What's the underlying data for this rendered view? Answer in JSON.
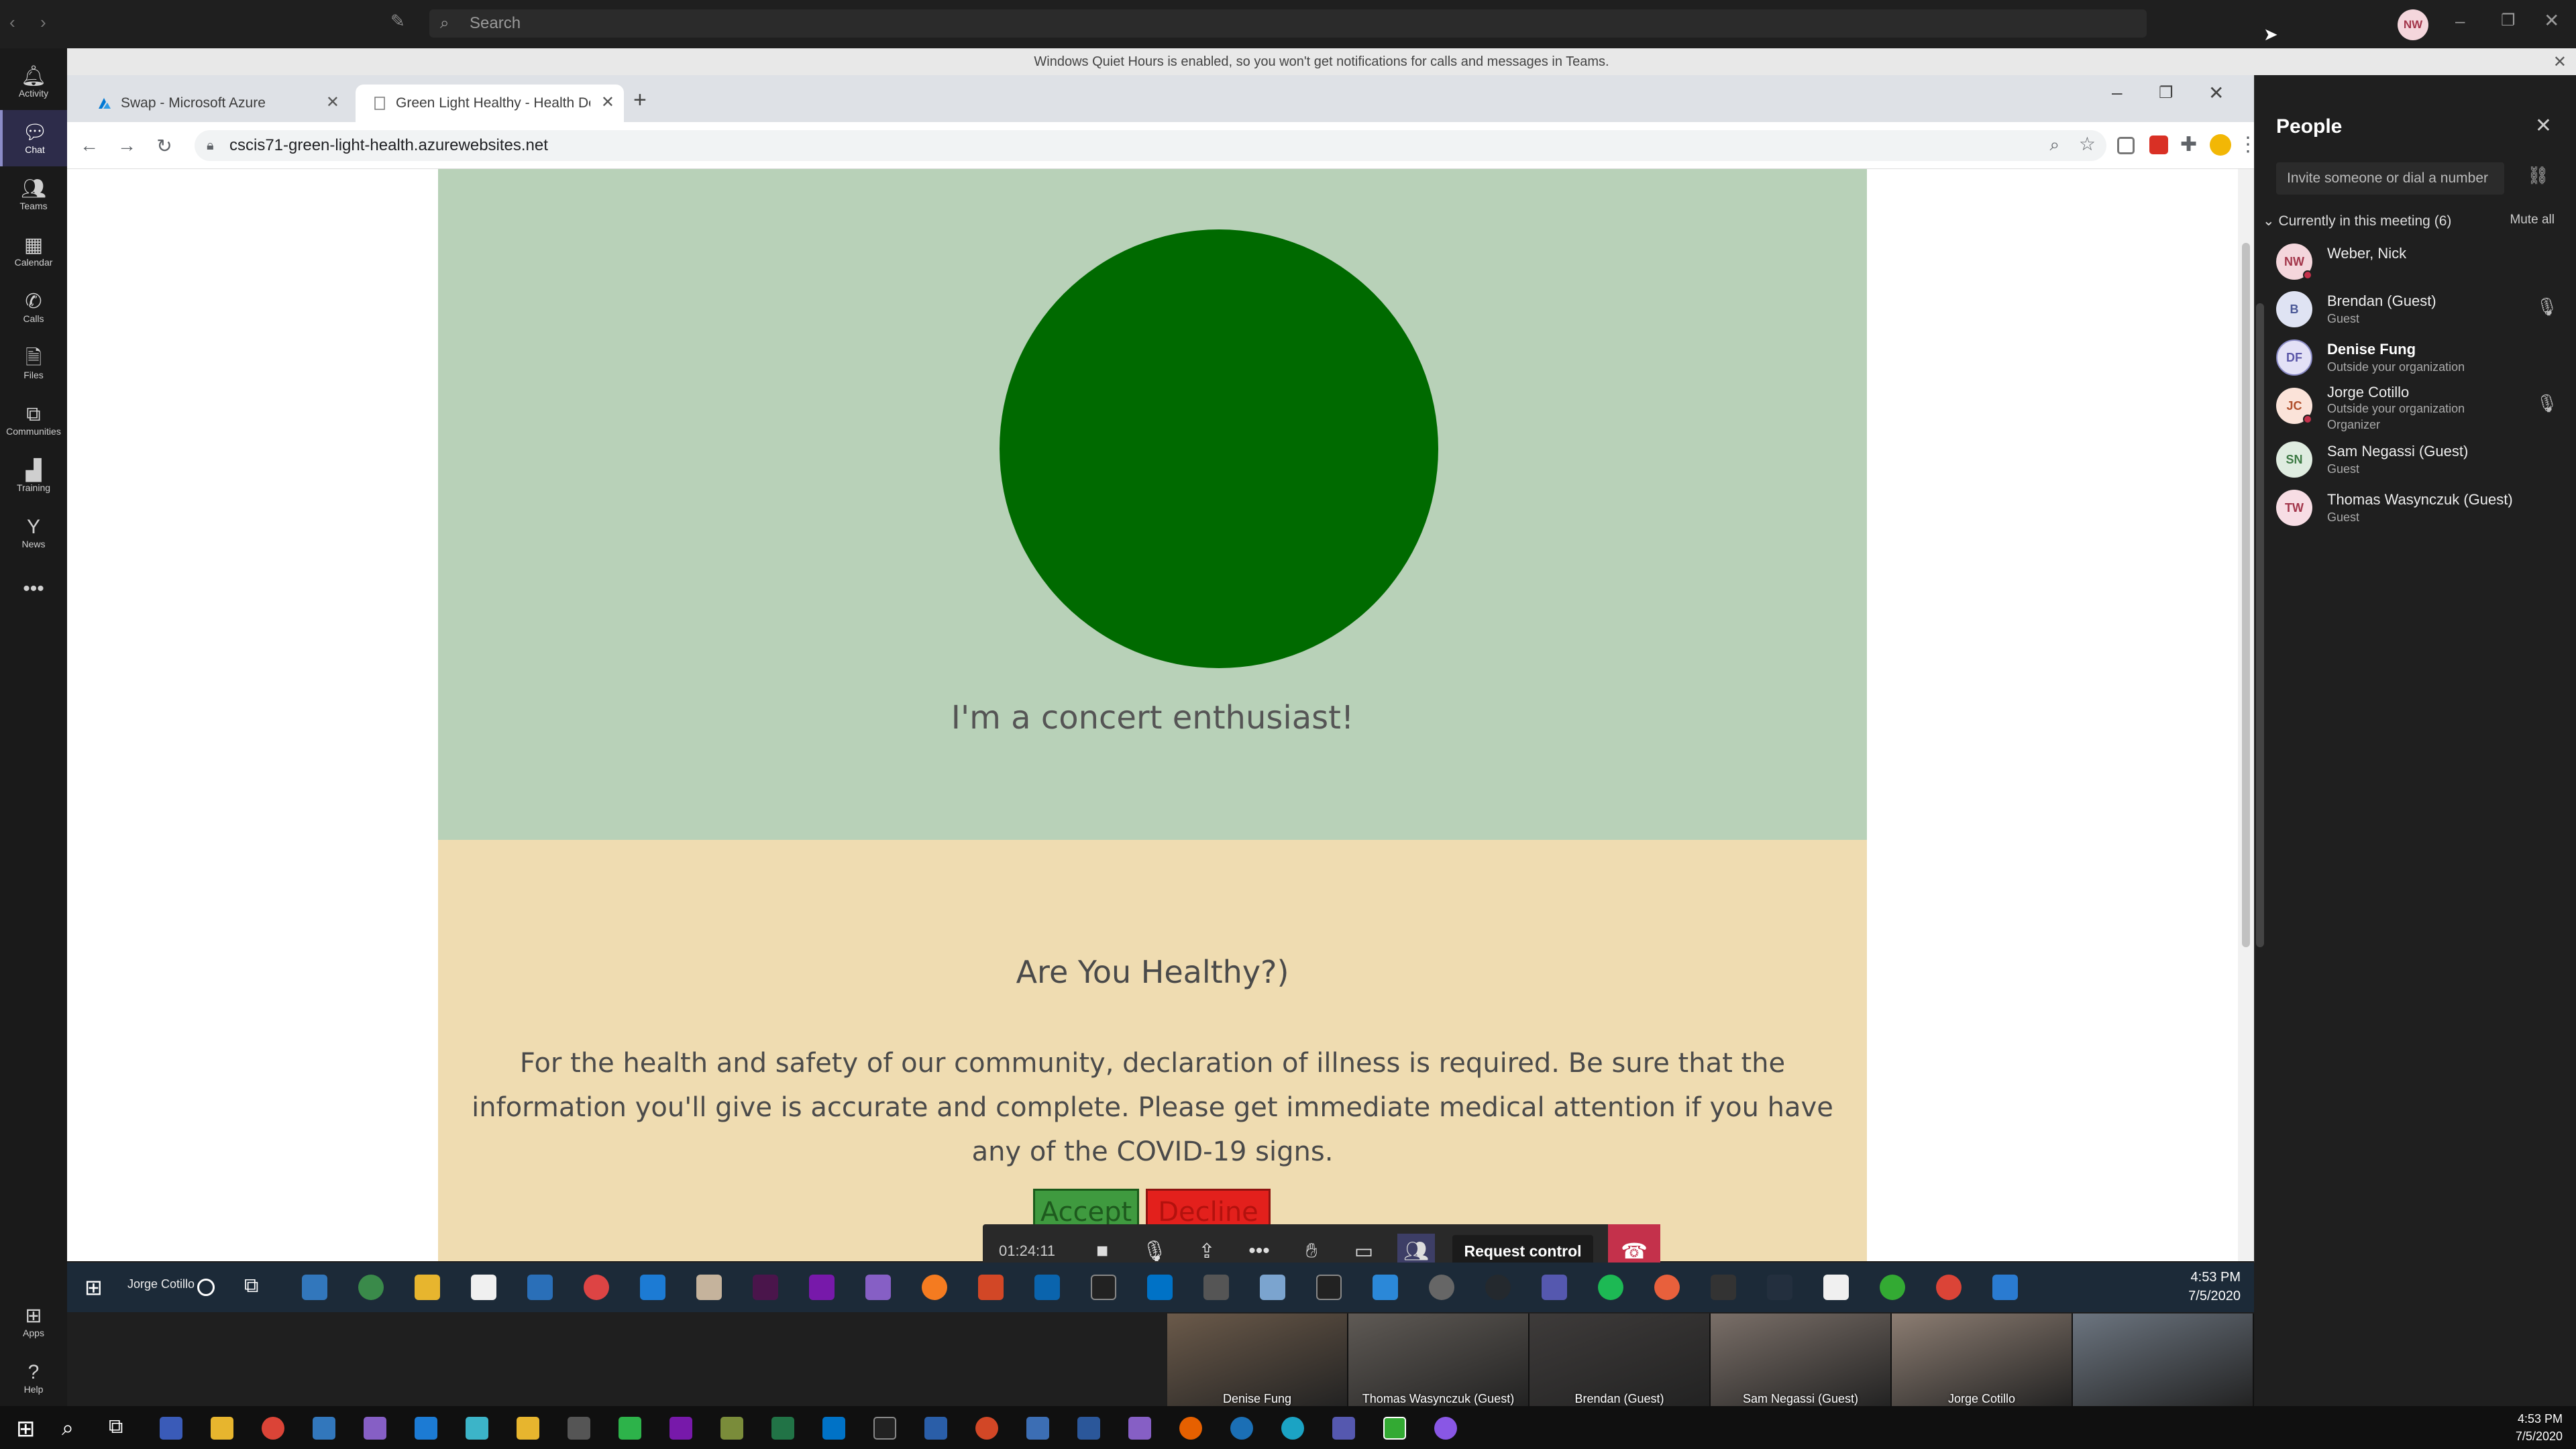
{
  "teams": {
    "search_placeholder": "Search",
    "user_initials": "NW",
    "banner": "Windows Quiet Hours is enabled, so you won't get notifications for calls and messages in Teams.",
    "rail": [
      {
        "label": "Activity",
        "icon": "bell-icon"
      },
      {
        "label": "Chat",
        "icon": "chat-icon"
      },
      {
        "label": "Teams",
        "icon": "teams-icon"
      },
      {
        "label": "Calendar",
        "icon": "calendar-icon"
      },
      {
        "label": "Calls",
        "icon": "phone-icon"
      },
      {
        "label": "Files",
        "icon": "file-icon"
      },
      {
        "label": "Communities",
        "icon": "communities-icon"
      },
      {
        "label": "Training",
        "icon": "training-icon"
      },
      {
        "label": "News",
        "icon": "news-icon"
      },
      {
        "label": "Apps",
        "icon": "apps-icon"
      },
      {
        "label": "Help",
        "icon": "help-icon"
      }
    ]
  },
  "browser": {
    "tabs": [
      {
        "title": "Swap - Microsoft Azure",
        "icon": "azure-icon"
      },
      {
        "title": "Green Light Healthy - Health Dec",
        "icon": "page-icon"
      }
    ],
    "url": "cscis71-green-light-health.azurewebsites.net"
  },
  "page": {
    "tagline": "I'm a concert enthusiast!",
    "status_color": "#006a00",
    "health_title": "Are You Healthy?)",
    "health_body": "For the health and safety of our community, declaration of illness is required. Be sure that the information you'll give is accurate and complete. Please get immediate medical attention if you have any of the COVID-19 signs.",
    "accept_label": "Accept",
    "decline_label": "Decline"
  },
  "call": {
    "timer": "01:24:11",
    "request_control": "Request control"
  },
  "remote_taskbar": {
    "user": "Jorge Cotillo",
    "time": "4:53 PM",
    "date": "7/5/2020"
  },
  "videos": [
    {
      "name": "Denise Fung",
      "bg": "#6b5a4a"
    },
    {
      "name": "Thomas Wasynczuk (Guest)",
      "bg": "#5f5a55"
    },
    {
      "name": "Brendan (Guest)",
      "bg": "#3e3b3a"
    },
    {
      "name": "Sam Negassi (Guest)",
      "bg": "#7a6f68"
    },
    {
      "name": "Jorge Cotillo",
      "bg": "#8c7d72"
    },
    {
      "name": "",
      "bg": "#6c7580"
    }
  ],
  "people": {
    "title": "People",
    "invite_placeholder": "Invite someone or dial a number",
    "meeting_header": "Currently in this meeting (6)",
    "mute_all": "Mute all",
    "list": [
      {
        "initials": "NW",
        "name": "Weber, Nick",
        "sub1": "",
        "sub2": "",
        "avatar_bg": "#f4d6dc",
        "avatar_fg": "#a3364b",
        "bold": false
      },
      {
        "initials": "B",
        "name": "Brendan (Guest)",
        "sub1": "Guest",
        "sub2": "",
        "avatar_bg": "#dfe3f3",
        "avatar_fg": "#4a5896",
        "bold": false
      },
      {
        "initials": "DF",
        "name": "Denise Fung",
        "sub1": "Outside your organization",
        "sub2": "",
        "avatar_bg": "#e3e1f6",
        "avatar_fg": "#5b57a8",
        "bold": true
      },
      {
        "initials": "JC",
        "name": "Jorge Cotillo",
        "sub1": "Outside your organization",
        "sub2": "Organizer",
        "avatar_bg": "#fbe3d9",
        "avatar_fg": "#b0502c",
        "bold": false
      },
      {
        "initials": "SN",
        "name": "Sam Negassi (Guest)",
        "sub1": "Guest",
        "sub2": "",
        "avatar_bg": "#dfece0",
        "avatar_fg": "#3d7a44",
        "bold": false
      },
      {
        "initials": "TW",
        "name": "Thomas Wasynczuk (Guest)",
        "sub1": "Guest",
        "sub2": "",
        "avatar_bg": "#f7dde4",
        "avatar_fg": "#a3364b",
        "bold": false
      }
    ]
  },
  "windows": {
    "time": "4:53 PM",
    "date": "7/5/2020"
  }
}
